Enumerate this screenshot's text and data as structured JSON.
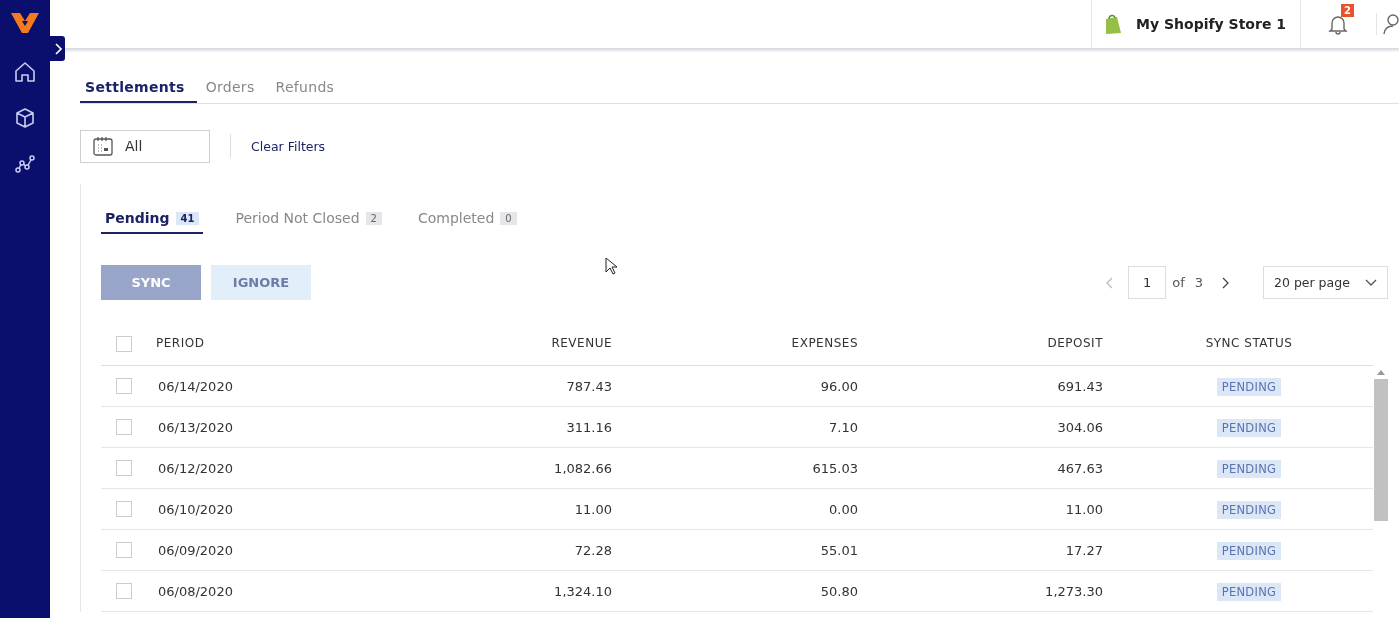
{
  "store": {
    "name": "My Shopify Store 1"
  },
  "notifications": {
    "count": "2"
  },
  "tabs": [
    {
      "label": "Settlements",
      "selected": true
    },
    {
      "label": "Orders",
      "selected": false
    },
    {
      "label": "Refunds",
      "selected": false
    }
  ],
  "filters": {
    "date": "All",
    "clear": "Clear Filters"
  },
  "status_tabs": [
    {
      "label": "Pending",
      "count": "41",
      "selected": true
    },
    {
      "label": "Period Not Closed",
      "count": "2",
      "selected": false
    },
    {
      "label": "Completed",
      "count": "0",
      "selected": false
    }
  ],
  "actions": [
    {
      "label": "SYNC",
      "kind": "primary"
    },
    {
      "label": "IGNORE",
      "kind": "secondary"
    }
  ],
  "pagination": {
    "page": "1",
    "of": "of",
    "total": "3",
    "per_page": "20 per page"
  },
  "table": {
    "select_all": {
      "checked": false
    },
    "columns": [
      "PERIOD",
      "REVENUE",
      "EXPENSES",
      "DEPOSIT",
      "SYNC STATUS"
    ],
    "rows": [
      {
        "period": "06/14/2020",
        "revenue": "787.43",
        "expenses": "96.00",
        "deposit": "691.43",
        "status": "PENDING",
        "checked": false
      },
      {
        "period": "06/13/2020",
        "revenue": "311.16",
        "expenses": "7.10",
        "deposit": "304.06",
        "status": "PENDING",
        "checked": false
      },
      {
        "period": "06/12/2020",
        "revenue": "1,082.66",
        "expenses": "615.03",
        "deposit": "467.63",
        "status": "PENDING",
        "checked": false
      },
      {
        "period": "06/10/2020",
        "revenue": "11.00",
        "expenses": "0.00",
        "deposit": "11.00",
        "status": "PENDING",
        "checked": false
      },
      {
        "period": "06/09/2020",
        "revenue": "72.28",
        "expenses": "55.01",
        "deposit": "17.27",
        "status": "PENDING",
        "checked": false
      },
      {
        "period": "06/08/2020",
        "revenue": "1,324.10",
        "expenses": "50.80",
        "deposit": "1,273.30",
        "status": "PENDING",
        "checked": false
      }
    ]
  }
}
